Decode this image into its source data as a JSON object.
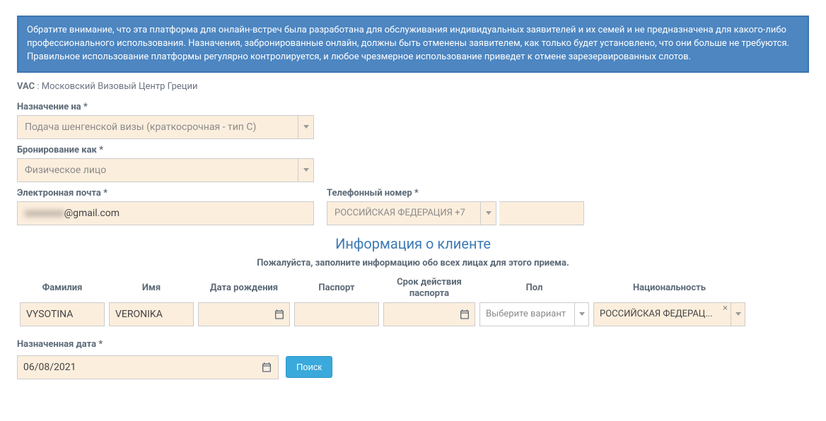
{
  "notice": "Обратите внимание, что эта платформа для онлайн-встреч была разработана для обслуживания индивидуальных заявителей и их семей и не предназначена для какого-либо профессионального использования. Назначения, забронированные онлайн, должны быть отменены заявителем, как только будет установлено, что они больше не требуются. Правильное использование платформы регулярно контролируется, и любое чрезмерное использование приведет к отмене зарезервированных слотов.",
  "vac": {
    "label": "VAC",
    "separator": " : ",
    "value": "Московский Визовый Центр Греции"
  },
  "form": {
    "appointment_for": {
      "label": "Назначение на *",
      "value": "Подача шенгенской визы (краткосрочная - тип C)"
    },
    "booking_as": {
      "label": "Бронирование как *",
      "value": "Физическое лицо"
    },
    "email": {
      "label": "Электронная почта *",
      "masked": "xxxxxxxx",
      "domain": "@gmail.com"
    },
    "phone": {
      "label": "Телефонный номер *",
      "country": "РОССИЙСКАЯ ФЕДЕРАЦИЯ +7",
      "number": ""
    }
  },
  "client": {
    "title": "Информация о клиенте",
    "subtitle": "Пожалуйста, заполните информацию обо всех лицах для этого приема.",
    "headers": {
      "surname": "Фамилия",
      "name": "Имя",
      "dob": "Дата рождения",
      "passport": "Паспорт",
      "passport_valid": "Срок действия паспорта",
      "gender": "Пол",
      "nationality": "Национальность"
    },
    "row": {
      "surname": "VYSOTINA",
      "name": "VERONIKA",
      "dob": "",
      "passport": "",
      "passport_valid": "",
      "gender_placeholder": "Выберите вариант",
      "nationality": "РОССИЙСКАЯ ФЕДЕРАЦ..."
    }
  },
  "appointed_date": {
    "label": "Назначенная дата *",
    "value": "06/08/2021"
  },
  "buttons": {
    "search": "Поиск"
  }
}
